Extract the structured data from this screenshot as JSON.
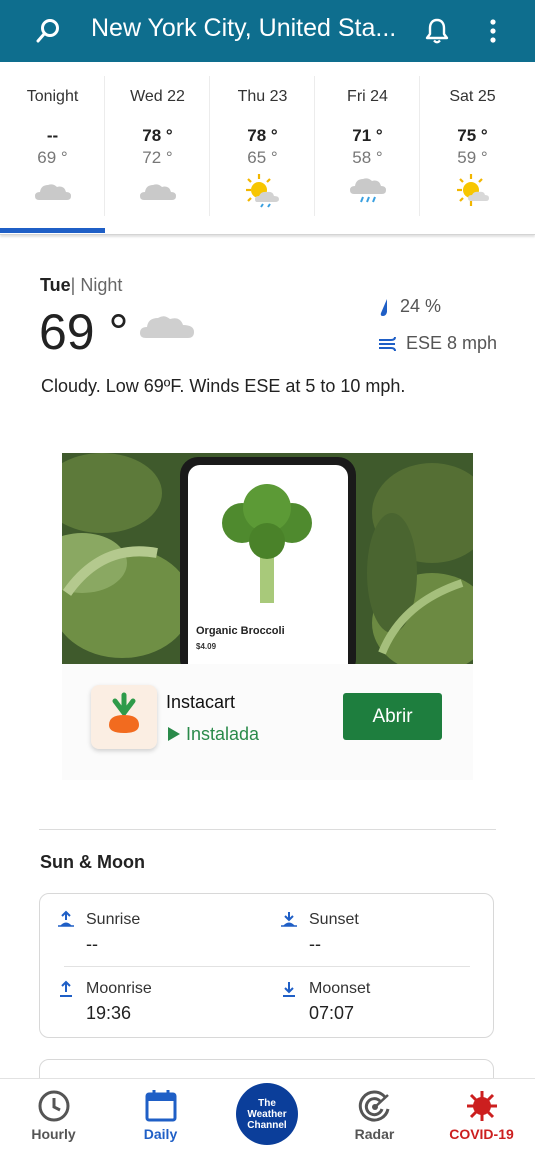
{
  "header": {
    "location": "New York City, United Sta..."
  },
  "days": [
    {
      "name": "Tonight",
      "hi": "--",
      "lo": "69 °",
      "icon": "cloud-icon"
    },
    {
      "name": "Wed 22",
      "hi": "78 °",
      "lo": "72 °",
      "icon": "cloud-icon"
    },
    {
      "name": "Thu 23",
      "hi": "78 °",
      "lo": "65 °",
      "icon": "sun-rain-icon"
    },
    {
      "name": "Fri 24",
      "hi": "71 °",
      "lo": "58 °",
      "icon": "rain-cloud-icon"
    },
    {
      "name": "Sat 25",
      "hi": "75 °",
      "lo": "59 °",
      "icon": "sun-cloud-icon"
    }
  ],
  "current": {
    "day": "Tue",
    "period": "| Night",
    "temp": "69 °",
    "precip": "24 %",
    "wind": "ESE 8 mph",
    "description": "Cloudy. Low 69ºF. Winds ESE at 5 to 10 mph."
  },
  "ad": {
    "product_name": "Organic Broccoli",
    "product_price": "$4.09",
    "app_name": "Instacart",
    "app_status": "Instalada",
    "open_label": "Abrir"
  },
  "sun_moon": {
    "title": "Sun & Moon",
    "sunrise_label": "Sunrise",
    "sunrise_value": "--",
    "sunset_label": "Sunset",
    "sunset_value": "--",
    "moonrise_label": "Moonrise",
    "moonrise_value": "19:36",
    "moonset_label": "Moonset",
    "moonset_value": "07:07"
  },
  "nav": {
    "hourly": "Hourly",
    "daily": "Daily",
    "logo_text": [
      "The",
      "Weather",
      "Channel"
    ],
    "radar": "Radar",
    "covid": "COVID-19"
  },
  "colors": {
    "header_bg": "#0e6e8e",
    "active_tab": "#1f5fc6",
    "open_button": "#1e7e3e",
    "covid": "#cc1f1f",
    "twc_logo": "#0b3e9a"
  }
}
